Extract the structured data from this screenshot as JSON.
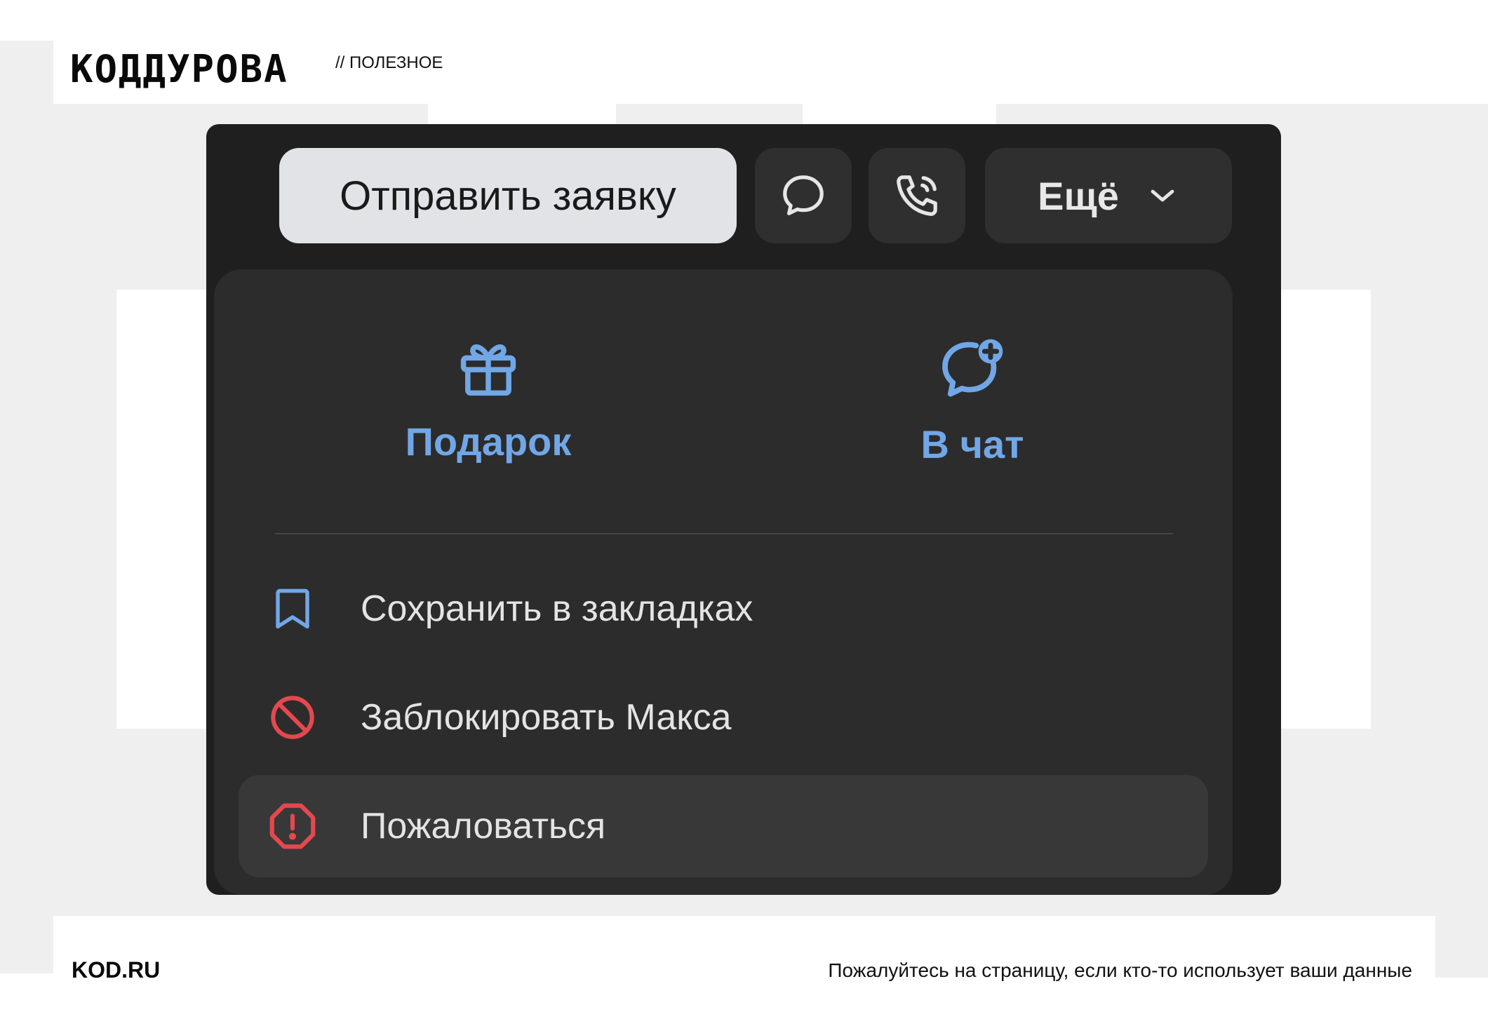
{
  "header": {
    "brand": "КОДДУРОВА",
    "tag": "// ПОЛЕЗНОЕ"
  },
  "footer": {
    "site": "KOD.RU",
    "caption": "Пожалуйтесь на страницу, если кто-то использует ваши данные"
  },
  "toolbar": {
    "primary_label": "Отправить заявку",
    "message_icon": "chat-bubble-icon",
    "call_icon": "phone-icon",
    "more_label": "Ещё",
    "more_icon": "chevron-down-icon"
  },
  "menu": {
    "quick_actions": [
      {
        "label": "Подарок",
        "icon": "gift-icon"
      },
      {
        "label": "В чат",
        "icon": "chat-add-icon"
      }
    ],
    "items": [
      {
        "label": "Сохранить в закладках",
        "icon": "bookmark-icon"
      },
      {
        "label": "Заблокировать Макса",
        "icon": "block-icon"
      },
      {
        "label": "Пожаловаться",
        "icon": "report-icon"
      }
    ]
  },
  "colors": {
    "accent_blue": "#71a7e7",
    "danger_red": "#e5484d",
    "window_bg": "#1f1f1f",
    "menu_bg": "#2c2c2c",
    "primary_button_bg": "#e1e3e6"
  }
}
